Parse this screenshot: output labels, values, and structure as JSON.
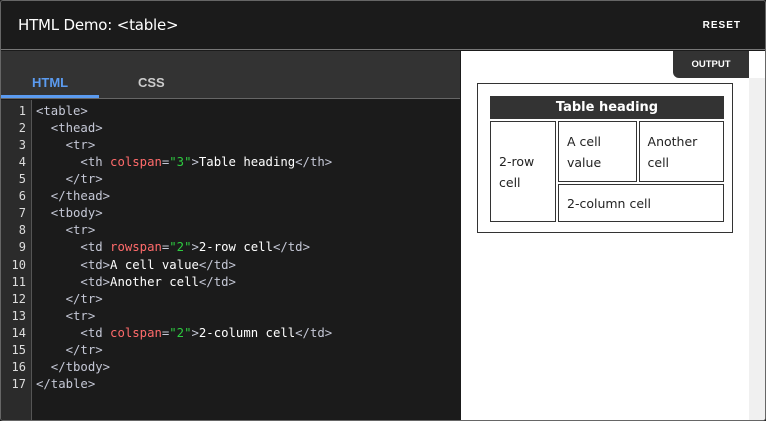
{
  "header": {
    "title": "HTML Demo: <table>",
    "reset_label": "RESET"
  },
  "tabs": [
    {
      "label": "HTML",
      "active": true
    },
    {
      "label": "CSS",
      "active": false
    }
  ],
  "colors": {
    "accent": "#5b9bf0",
    "tag": "#c5c8d6",
    "attr": "#ff6b6b",
    "value": "#2ecc40"
  },
  "code": [
    [
      {
        "c": "tag",
        "t": "<table>"
      }
    ],
    [
      {
        "c": "tag",
        "t": "  <thead>"
      }
    ],
    [
      {
        "c": "tag",
        "t": "    <tr>"
      }
    ],
    [
      {
        "c": "tag",
        "t": "      <th "
      },
      {
        "c": "attr",
        "t": "colspan"
      },
      {
        "c": "tag",
        "t": "="
      },
      {
        "c": "val",
        "t": "\"3\""
      },
      {
        "c": "tag",
        "t": ">"
      },
      {
        "c": "txt",
        "t": "Table heading"
      },
      {
        "c": "tag",
        "t": "</th>"
      }
    ],
    [
      {
        "c": "tag",
        "t": "    </tr>"
      }
    ],
    [
      {
        "c": "tag",
        "t": "  </thead>"
      }
    ],
    [
      {
        "c": "tag",
        "t": "  <tbody>"
      }
    ],
    [
      {
        "c": "tag",
        "t": "    <tr>"
      }
    ],
    [
      {
        "c": "tag",
        "t": "      <td "
      },
      {
        "c": "attr",
        "t": "rowspan"
      },
      {
        "c": "tag",
        "t": "="
      },
      {
        "c": "val",
        "t": "\"2\""
      },
      {
        "c": "tag",
        "t": ">"
      },
      {
        "c": "txt",
        "t": "2-row cell"
      },
      {
        "c": "tag",
        "t": "</td>"
      }
    ],
    [
      {
        "c": "tag",
        "t": "      <td>"
      },
      {
        "c": "txt",
        "t": "A cell value"
      },
      {
        "c": "tag",
        "t": "</td>"
      }
    ],
    [
      {
        "c": "tag",
        "t": "      <td>"
      },
      {
        "c": "txt",
        "t": "Another cell"
      },
      {
        "c": "tag",
        "t": "</td>"
      }
    ],
    [
      {
        "c": "tag",
        "t": "    </tr>"
      }
    ],
    [
      {
        "c": "tag",
        "t": "    <tr>"
      }
    ],
    [
      {
        "c": "tag",
        "t": "      <td "
      },
      {
        "c": "attr",
        "t": "colspan"
      },
      {
        "c": "tag",
        "t": "="
      },
      {
        "c": "val",
        "t": "\"2\""
      },
      {
        "c": "tag",
        "t": ">"
      },
      {
        "c": "txt",
        "t": "2-column cell"
      },
      {
        "c": "tag",
        "t": "</td>"
      }
    ],
    [
      {
        "c": "tag",
        "t": "    </tr>"
      }
    ],
    [
      {
        "c": "tag",
        "t": "  </tbody>"
      }
    ],
    [
      {
        "c": "tag",
        "t": "</table>"
      }
    ]
  ],
  "output": {
    "tab_label": "OUTPUT",
    "heading": "Table heading",
    "cells": {
      "two_row": "2-row cell",
      "a_cell": "A cell value",
      "another": "Another cell",
      "two_col": "2-column cell"
    }
  }
}
